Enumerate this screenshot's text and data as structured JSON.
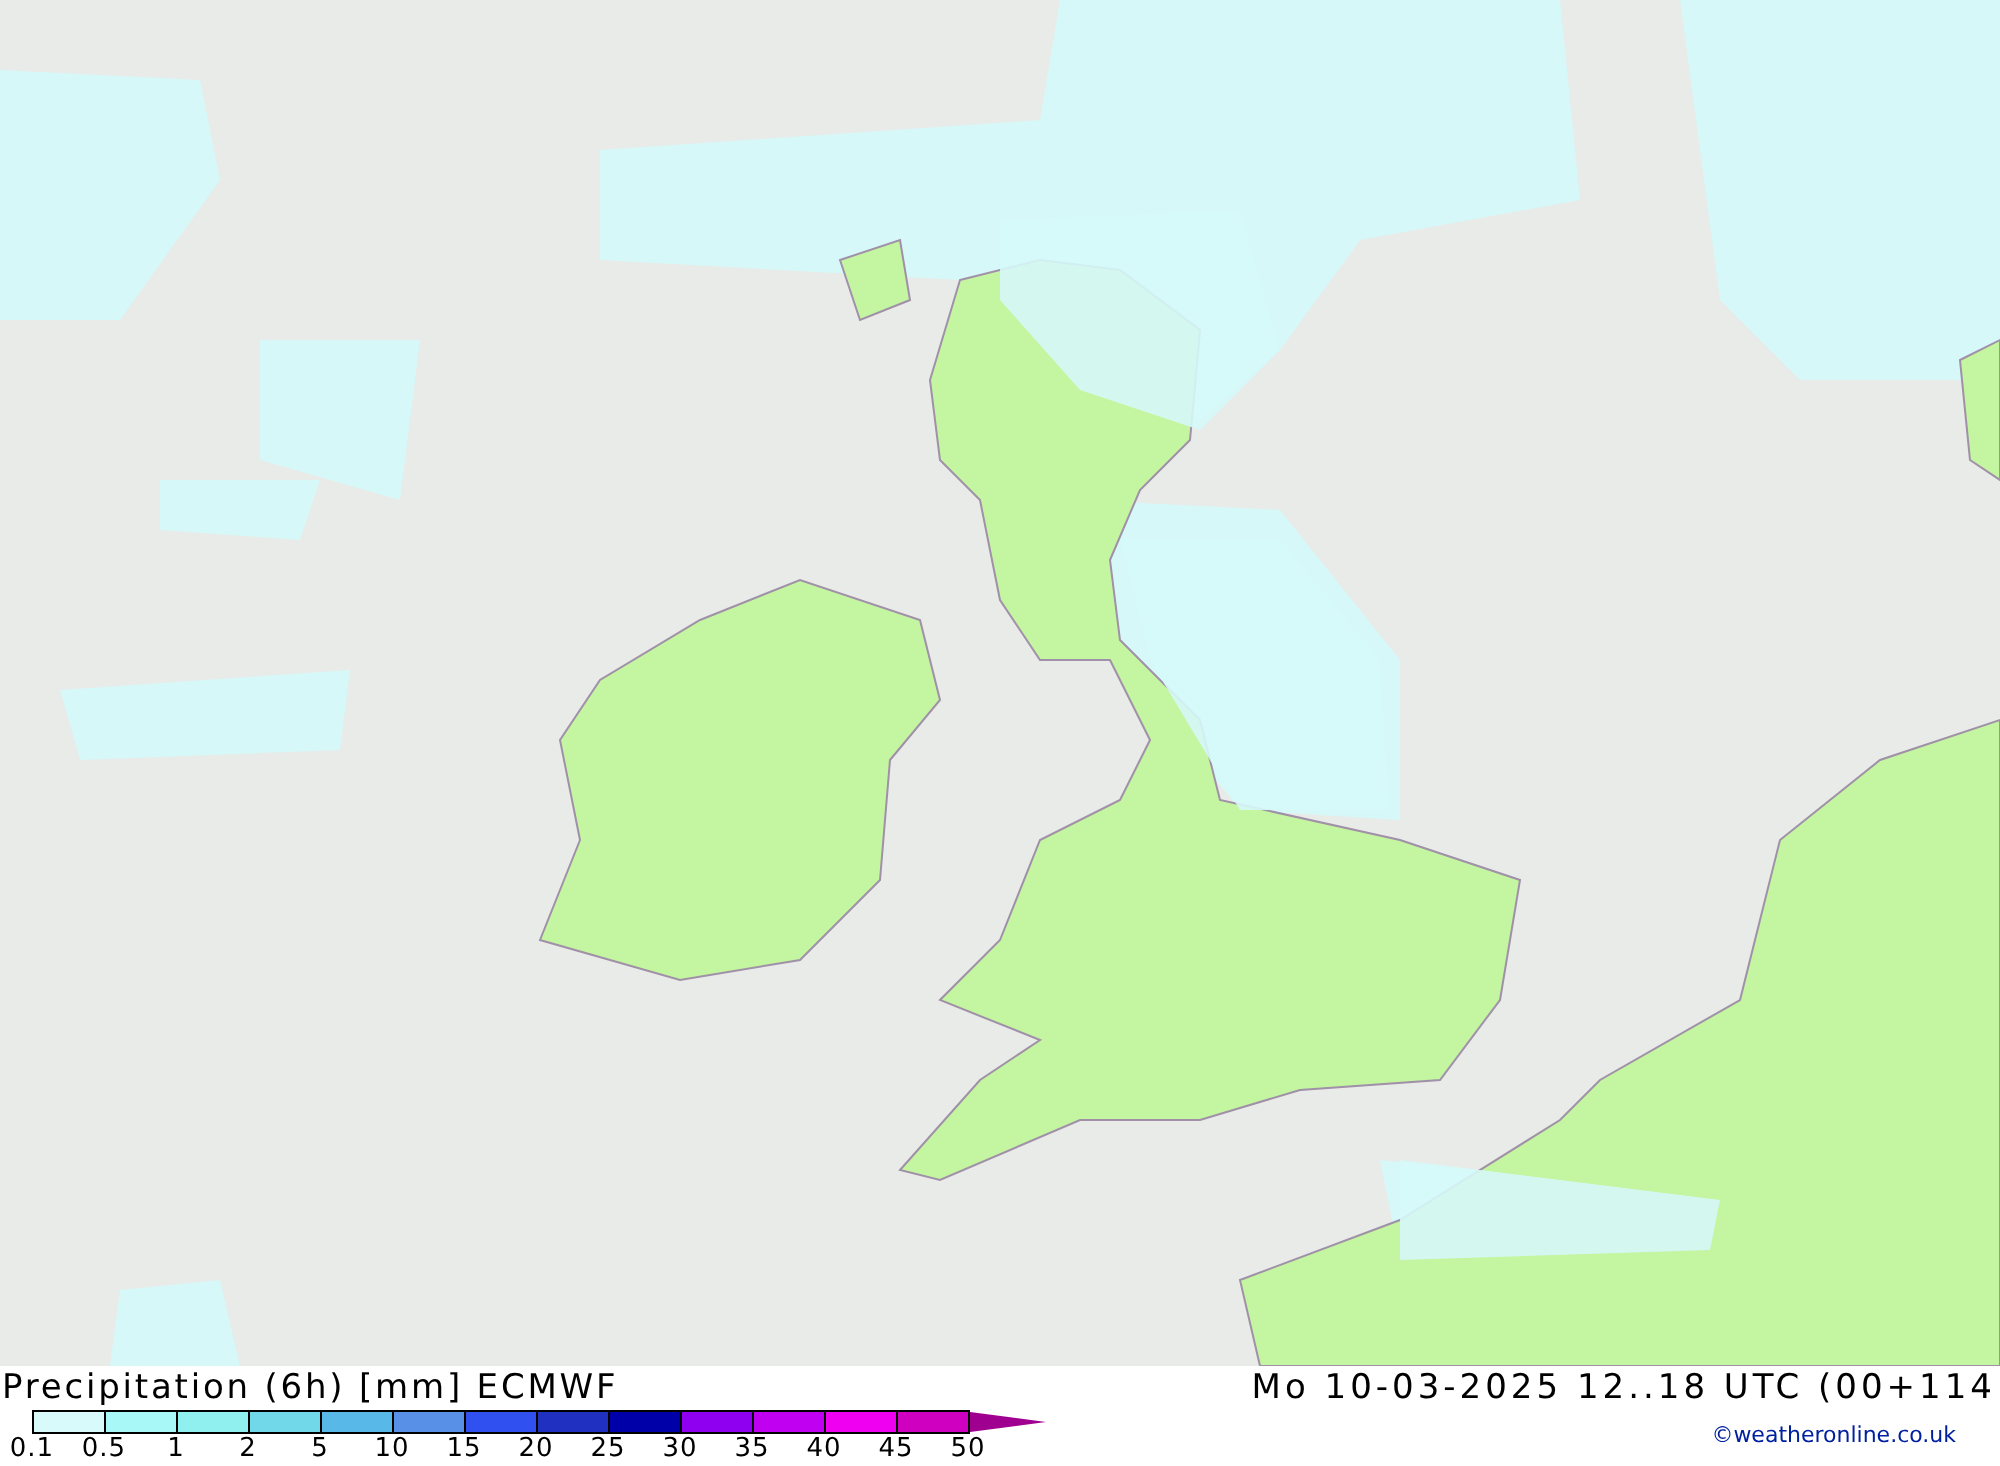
{
  "title": "Precipitation (6h) [mm] ECMWF",
  "valid_time": "Mo 10-03-2025 12..18 UTC (00+114",
  "legend": [
    {
      "label": "0.1",
      "color": "#d8fafa"
    },
    {
      "label": "0.5",
      "color": "#a8f8f8"
    },
    {
      "label": "1",
      "color": "#90f0f0"
    },
    {
      "label": "2",
      "color": "#70d8e8"
    },
    {
      "label": "5",
      "color": "#58b8e8"
    },
    {
      "label": "10",
      "color": "#5890e8"
    },
    {
      "label": "15",
      "color": "#3050f0"
    },
    {
      "label": "20",
      "color": "#2030c0"
    },
    {
      "label": "25",
      "color": "#0000a8"
    },
    {
      "label": "30",
      "color": "#9000f0"
    },
    {
      "label": "35",
      "color": "#c000f0"
    },
    {
      "label": "40",
      "color": "#f000f0"
    },
    {
      "label": "45",
      "color": "#d000c0"
    },
    {
      "label": "50",
      "color": "#a00090"
    }
  ],
  "credit": "©weatheronline.co.uk"
}
